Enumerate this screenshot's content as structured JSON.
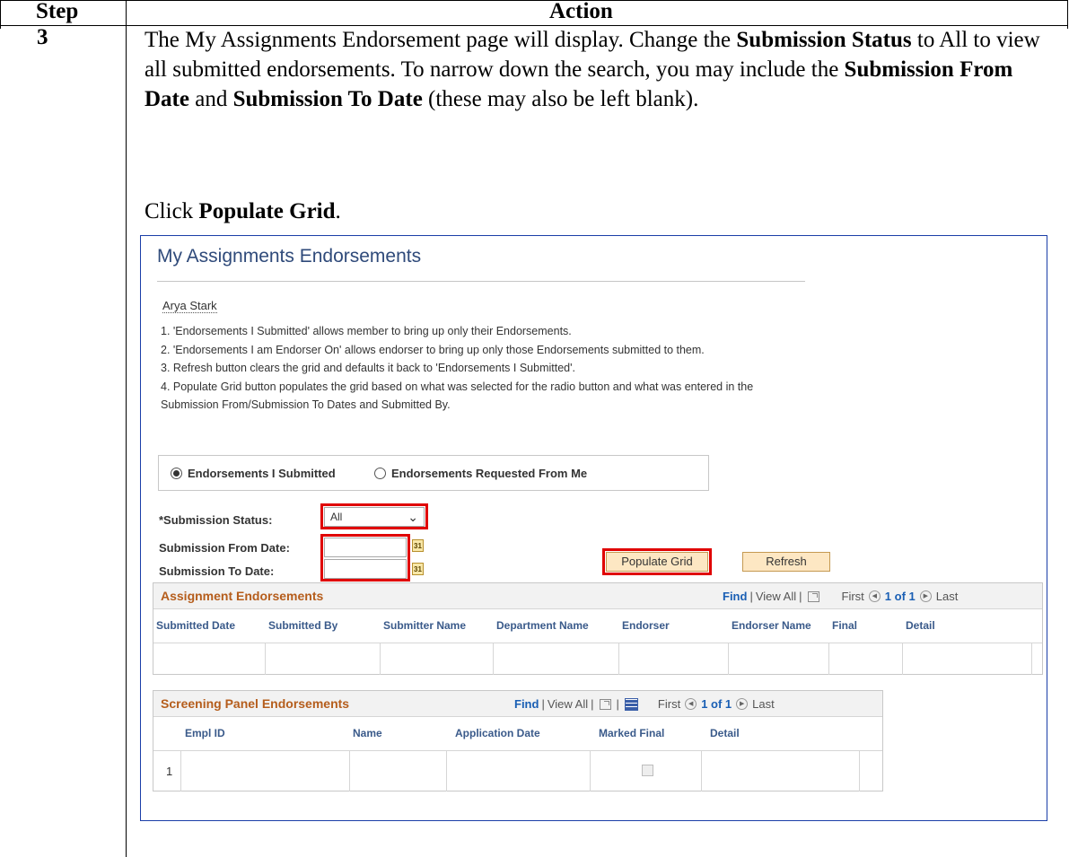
{
  "doc": {
    "header": {
      "step": "Step",
      "action": "Action"
    },
    "step_number": "3",
    "paragraph": [
      {
        "text": "The My Assignments Endorsement page will display.  Change the ",
        "bold": false
      },
      {
        "text": "Submission Status",
        "bold": true
      },
      {
        "text": " to All to view all submitted endorsements.  To narrow down the search, you may include the ",
        "bold": false
      },
      {
        "text": "Submission From Date",
        "bold": true
      },
      {
        "text": " and ",
        "bold": false
      },
      {
        "text": "Submission To Date",
        "bold": true
      },
      {
        "text": " (these may also be left blank).",
        "bold": false
      }
    ],
    "click_prefix": "Click ",
    "click_target": "Populate Grid",
    "click_suffix": "."
  },
  "page": {
    "title": "My Assignments Endorsements",
    "user_name": "Arya Stark",
    "notes": [
      "1. 'Endorsements I Submitted' allows member to bring up only their Endorsements.",
      "2. 'Endorsements I am Endorser On' allows endorser to bring up only those Endorsements submitted to them.",
      "3. Refresh button clears the grid and defaults it back to 'Endorsements I Submitted'.",
      "4. Populate Grid button populates the grid based on what was selected for the radio button and what was entered in the",
      "Submission From/Submission To Dates and Submitted By."
    ],
    "radios": [
      {
        "label": "Endorsements I Submitted",
        "selected": true
      },
      {
        "label": "Endorsements Requested From Me",
        "selected": false
      }
    ],
    "submission_status_label": "*Submission Status:",
    "submission_status_value": "All",
    "from_date_label": "Submission From Date:",
    "to_date_label": "Submission To Date:",
    "from_date_value": "",
    "to_date_value": "",
    "calendar_icon_text": "31",
    "populate_button": "Populate Grid",
    "refresh_button": "Refresh",
    "highlight_color": "#e00000"
  },
  "grid1": {
    "title": "Assignment Endorsements",
    "find": "Find",
    "view_all": "View All",
    "first": "First",
    "pager": "1 of 1",
    "last": "Last",
    "columns": [
      "Submitted Date",
      "Submitted By",
      "Submitter Name",
      "Department Name",
      "Endorser",
      "Endorser Name",
      "Final",
      "Detail"
    ]
  },
  "grid2": {
    "title": "Screening Panel Endorsements",
    "find": "Find",
    "view_all": "View All",
    "first": "First",
    "pager": "1 of 1",
    "last": "Last",
    "columns": [
      "Empl ID",
      "Name",
      "Application Date",
      "Marked Final",
      "Detail"
    ],
    "row_number": "1"
  }
}
